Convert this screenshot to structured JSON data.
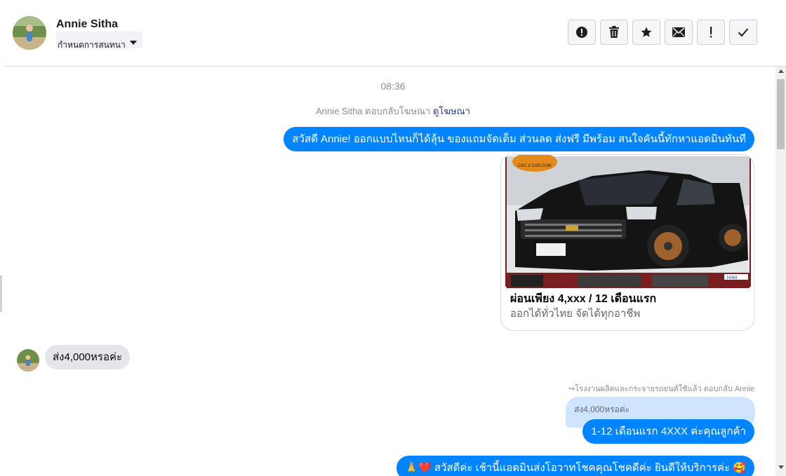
{
  "header": {
    "contact_name": "Annie Sitha",
    "label_dropdown": "กำหนดการสนทนา",
    "actions": [
      {
        "name": "report-spam-button",
        "icon": "alert-circle-icon"
      },
      {
        "name": "delete-button",
        "icon": "trash-icon"
      },
      {
        "name": "star-button",
        "icon": "star-icon"
      },
      {
        "name": "mark-unread-button",
        "icon": "envelope-icon"
      },
      {
        "name": "follow-up-button",
        "icon": "exclamation-icon"
      },
      {
        "name": "mark-done-button",
        "icon": "check-icon"
      }
    ]
  },
  "thread": {
    "time": "08:36",
    "ad_reply_text": "Annie Sitha ตอบกลับโฆษณา",
    "ad_reply_link": "ดูโฆษณา",
    "msg1": "สวัสดี Annie! ออกแบบไหนก็ได้ลุ้น ของแถมจัดเต็ม ส่วนลด ส่งฟรี มีพร้อม สนใจคันนี้ทักหาแอดมินทันที",
    "ad_card": {
      "logo_text": "CKC 2 CAR.COM",
      "corner_code": "H069",
      "title": "ผ่อนเพียง 4,xxx / 12 เดือนแรก",
      "subtitle": "ออกได้ทั่วไทย จัดได้ทุกอาชีพ"
    },
    "msg2": "ส่ง4,000หรอค่ะ",
    "reply_note": "↪โรงงานผลิตและกระจายรถยนต์ใช้แล้ว ตอบกลับ Annie",
    "quoted_text": "ส่ง4,000หรอค่ะ",
    "msg3": "1-12 เดือนแรก 4XXX ค่ะคุณลูกค้า",
    "msg4": "🙏❤️ สวัสดีค่ะ เช้านี้แอดมินส่งโอวาทโชคคุณโชคดีค่ะ ยินดีให้บริการค่ะ 🥰"
  },
  "colors": {
    "outgoing_bubble": "#0084ff",
    "incoming_bubble": "#e4e6eb",
    "quoted_bubble": "#cfe4ff",
    "link": "#2a3b8f"
  }
}
